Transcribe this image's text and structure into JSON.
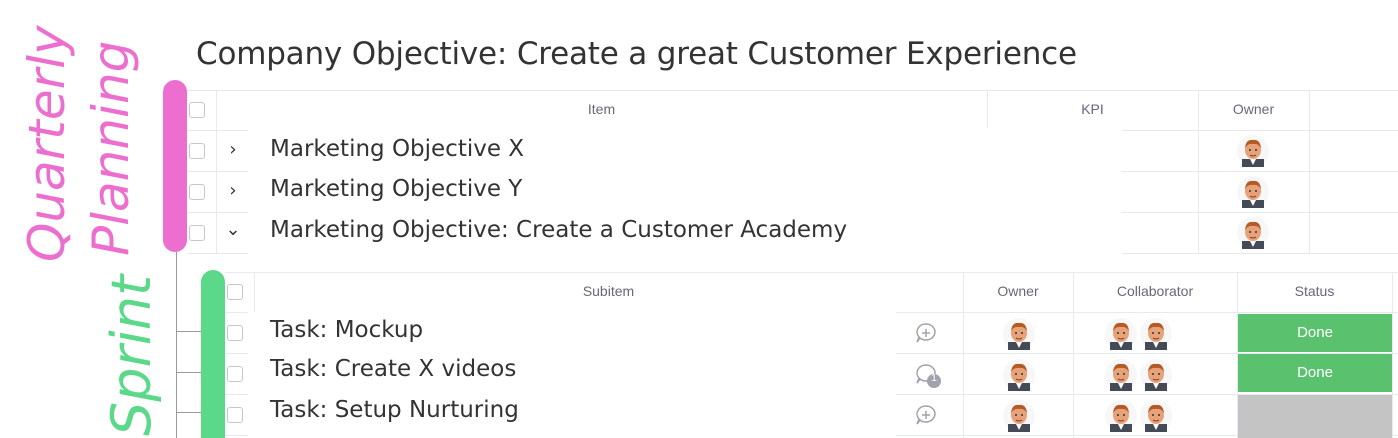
{
  "title": "Company Objective: Create a great Customer Experience",
  "side_labels": {
    "quarterly_line1": "Quarterly",
    "quarterly_line2": "Planning",
    "sprint": "Sprint"
  },
  "items_table": {
    "headers": {
      "item": "Item",
      "kpi": "KPI",
      "owner": "Owner"
    },
    "rows": [
      {
        "name": "Marketing Objective X",
        "expanded": false,
        "owner_icon": "avatar-icon"
      },
      {
        "name": "Marketing Objective Y",
        "expanded": false,
        "owner_icon": "avatar-icon"
      },
      {
        "name": "Marketing Objective: Create a Customer Academy",
        "expanded": true,
        "owner_icon": "avatar-icon"
      }
    ]
  },
  "subitems_table": {
    "headers": {
      "subitem": "Subitem",
      "owner": "Owner",
      "collaborator": "Collaborator",
      "status": "Status"
    },
    "rows": [
      {
        "name": "Task: Mockup",
        "update_icon": "add-update-icon",
        "status": "Done",
        "status_color": "#5ac26f"
      },
      {
        "name": "Task: Create X videos",
        "update_icon": "update-count-icon",
        "update_count": "1",
        "status": "Done",
        "status_color": "#5ac26f"
      },
      {
        "name": "Task: Setup Nurturing",
        "update_icon": "add-update-icon",
        "status": "",
        "status_color": "#c4c4c4"
      }
    ]
  },
  "chevrons": {
    "collapsed": "›",
    "expanded": "⌄"
  },
  "colors": {
    "quarterly": "#ec6fcf",
    "sprint": "#5bd889",
    "done": "#5ac26f",
    "empty": "#c4c4c4"
  }
}
